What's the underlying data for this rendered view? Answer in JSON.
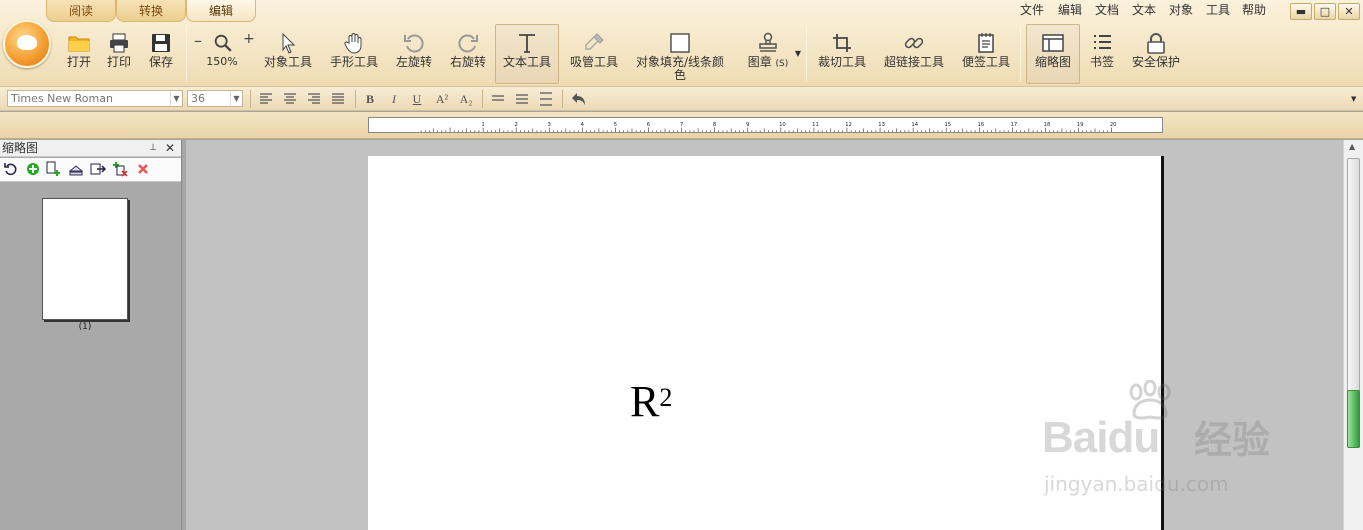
{
  "tabs": [
    "阅读",
    "转换",
    "编辑"
  ],
  "menu": [
    "文件",
    "编辑",
    "文档",
    "文本",
    "对象",
    "工具",
    "帮助"
  ],
  "window_buttons": [
    "▬",
    "□",
    "✕"
  ],
  "toolbar": {
    "open": "打开",
    "print": "打印",
    "save": "保存",
    "zoom": "150%",
    "zoom_minus": "–",
    "zoom_plus": "+",
    "object_tool": "对象工具",
    "hand_tool": "手形工具",
    "rotate_left": "左旋转",
    "rotate_right": "右旋转",
    "text_tool": "文本工具",
    "eyedropper_tool": "吸管工具",
    "fill_line_line1": "对象填充/线条颜",
    "fill_line_line2": "色",
    "stamp": "图章",
    "stamp_shortcut": "(S)",
    "crop_tool": "裁切工具",
    "hyperlink_tool": "超链接工具",
    "note_tool": "便签工具",
    "thumbnails": "缩略图",
    "bookmarks": "书签",
    "security": "安全保护"
  },
  "format": {
    "font": "Times New Roman",
    "size": "36",
    "bold": "B",
    "italic": "I",
    "underline": "U",
    "superscript": "A²",
    "subscript": "A₂"
  },
  "ruler_numbers": [
    "1",
    "2",
    "3",
    "4",
    "5",
    "6",
    "7",
    "8",
    "9",
    "10",
    "11",
    "12",
    "13",
    "14",
    "15",
    "16",
    "17",
    "18",
    "19",
    "20"
  ],
  "left_panel": {
    "title": "缩略图",
    "pin": "📌",
    "close": "✕",
    "page_label": "(1)"
  },
  "document": {
    "text": "R",
    "superscript": "2"
  },
  "watermark": {
    "brand": "Bai",
    "brand_suffix": "du",
    "cn": "经验",
    "url": "jingyan.baidu.com"
  },
  "colors": {
    "ribbon_top": "#fbf2dd",
    "ribbon_bottom": "#efdcb4",
    "tab_text": "#7a4a10",
    "canvas": "#c2c2c2",
    "panel": "#a9a9a9"
  }
}
